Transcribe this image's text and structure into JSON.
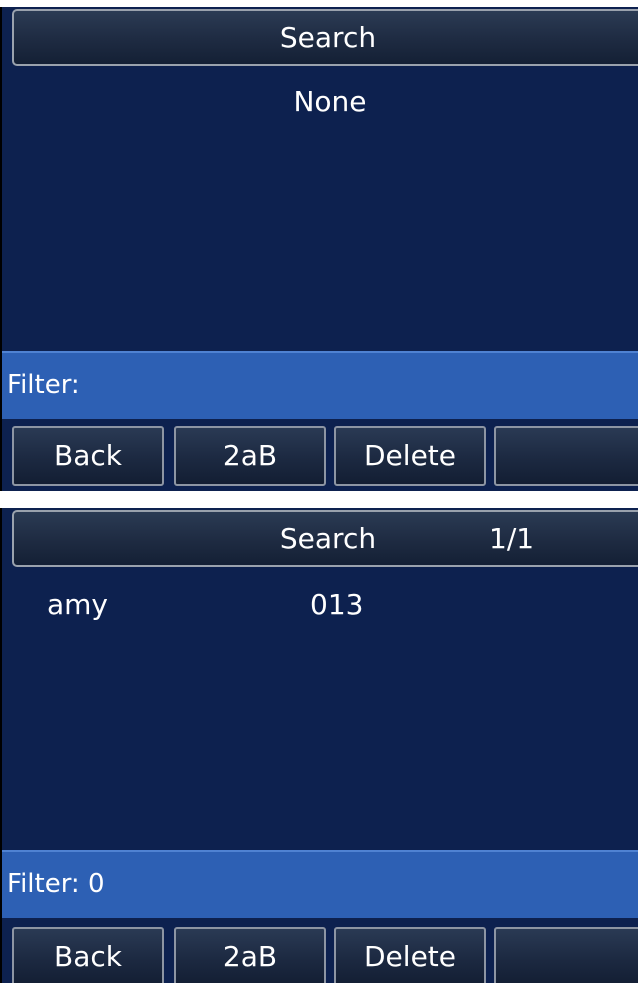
{
  "screen1": {
    "title": "Search",
    "empty_message": "None",
    "filter_text": "Filter:",
    "softkeys": [
      "Back",
      "2aB",
      "Delete",
      ""
    ]
  },
  "screen2": {
    "title": "Search",
    "page_indicator": "1/1",
    "results": [
      {
        "name": "amy",
        "number": "013"
      }
    ],
    "filter_text": "Filter: 0",
    "softkeys": [
      "Back",
      "2aB",
      "Delete",
      ""
    ]
  },
  "colors": {
    "screen_background": "#0d214f",
    "filter_bar": "#2d60b4",
    "text": "#ffffff"
  }
}
